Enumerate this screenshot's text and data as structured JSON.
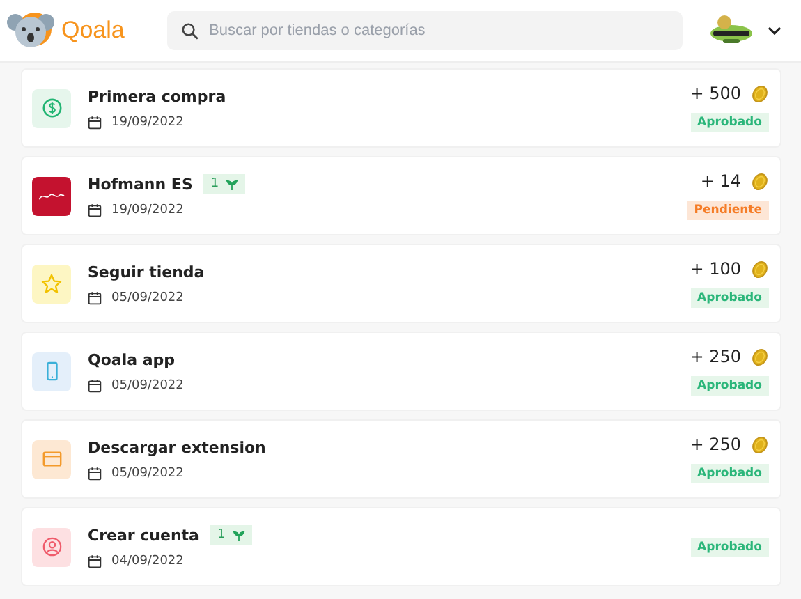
{
  "header": {
    "brand": "Qoala",
    "search": {
      "placeholder": "Buscar por tiendas o categorías"
    }
  },
  "activities": [
    {
      "kind": "dollar",
      "title": "Primera compra",
      "date": "19/09/2022",
      "amount": "+ 500",
      "status": {
        "kind": "approved",
        "label": "Aprobado"
      }
    },
    {
      "kind": "store",
      "title": "Hofmann ES",
      "badge": "1",
      "date": "19/09/2022",
      "amount": "+ 14",
      "status": {
        "kind": "pending",
        "label": "Pendiente"
      }
    },
    {
      "kind": "star",
      "title": "Seguir tienda",
      "date": "05/09/2022",
      "amount": "+ 100",
      "status": {
        "kind": "approved",
        "label": "Aprobado"
      }
    },
    {
      "kind": "phone",
      "title": "Qoala app",
      "date": "05/09/2022",
      "amount": "+ 250",
      "status": {
        "kind": "approved",
        "label": "Aprobado"
      }
    },
    {
      "kind": "browser",
      "title": "Descargar extension",
      "date": "05/09/2022",
      "amount": "+ 250",
      "status": {
        "kind": "approved",
        "label": "Aprobado"
      }
    },
    {
      "kind": "user",
      "title": "Crear cuenta",
      "badge": "1",
      "date": "04/09/2022",
      "status": {
        "kind": "approved",
        "label": "Aprobado"
      }
    }
  ]
}
